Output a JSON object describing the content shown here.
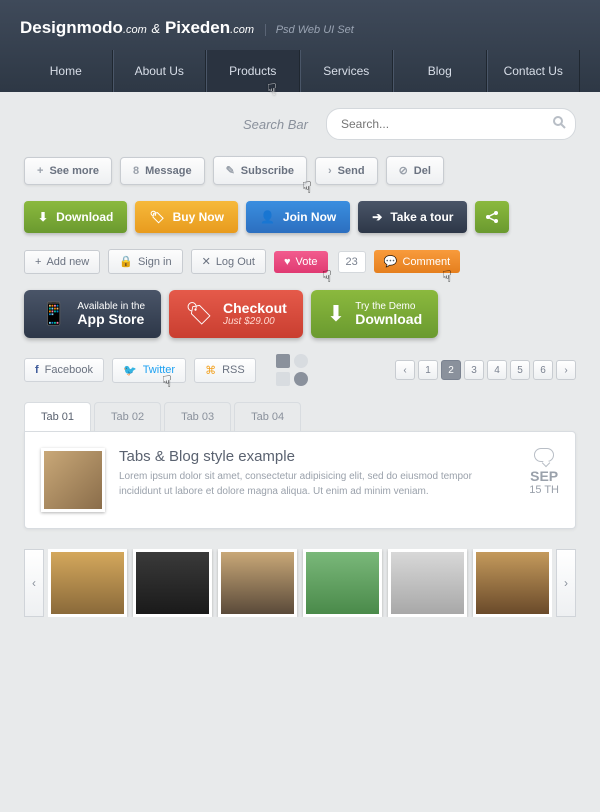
{
  "header": {
    "brand1": "Designmodo",
    "brand1suffix": ".com",
    "amp": "&",
    "brand2": "Pixeden",
    "brand2suffix": ".com",
    "subtitle": "Psd Web UI Set"
  },
  "nav": [
    "Home",
    "About Us",
    "Products",
    "Services",
    "Blog",
    "Contact Us"
  ],
  "search": {
    "label": "Search Bar",
    "placeholder": "Search..."
  },
  "grayButtons": [
    {
      "icon": "+",
      "label": "See more"
    },
    {
      "icon": "8",
      "label": "Message"
    },
    {
      "icon": "✎",
      "label": "Subscribe"
    },
    {
      "icon": "›",
      "label": "Send"
    },
    {
      "icon": "⊘",
      "label": "Del"
    }
  ],
  "colorButtons": {
    "download": "Download",
    "buy": "Buy Now",
    "join": "Join Now",
    "tour": "Take a tour"
  },
  "smallButtons": {
    "addnew": "Add new",
    "signin": "Sign in",
    "logout": "Log Out",
    "vote": "Vote",
    "voteCount": "23",
    "comment": "Comment"
  },
  "bigButtons": {
    "appstore": {
      "line1": "Available in the",
      "line2": "App Store"
    },
    "checkout": {
      "line1": "Checkout",
      "line2": "Just $29.00"
    },
    "download": {
      "line1": "Try the Demo",
      "line2": "Download"
    }
  },
  "social": {
    "fb": "Facebook",
    "tw": "Twitter",
    "rss": "RSS"
  },
  "pages": [
    "1",
    "2",
    "3",
    "4",
    "5",
    "6"
  ],
  "tabs": [
    "Tab 01",
    "Tab 02",
    "Tab 03",
    "Tab 04"
  ],
  "tabContent": {
    "title": "Tabs & Blog style example",
    "body": "Lorem ipsum dolor sit amet, consectetur adipisicing elit, sed do eiusmod tempor incididunt ut labore et dolore magna aliqua. Ut enim ad minim veniam.",
    "month": "SEP",
    "day": "15 TH"
  }
}
